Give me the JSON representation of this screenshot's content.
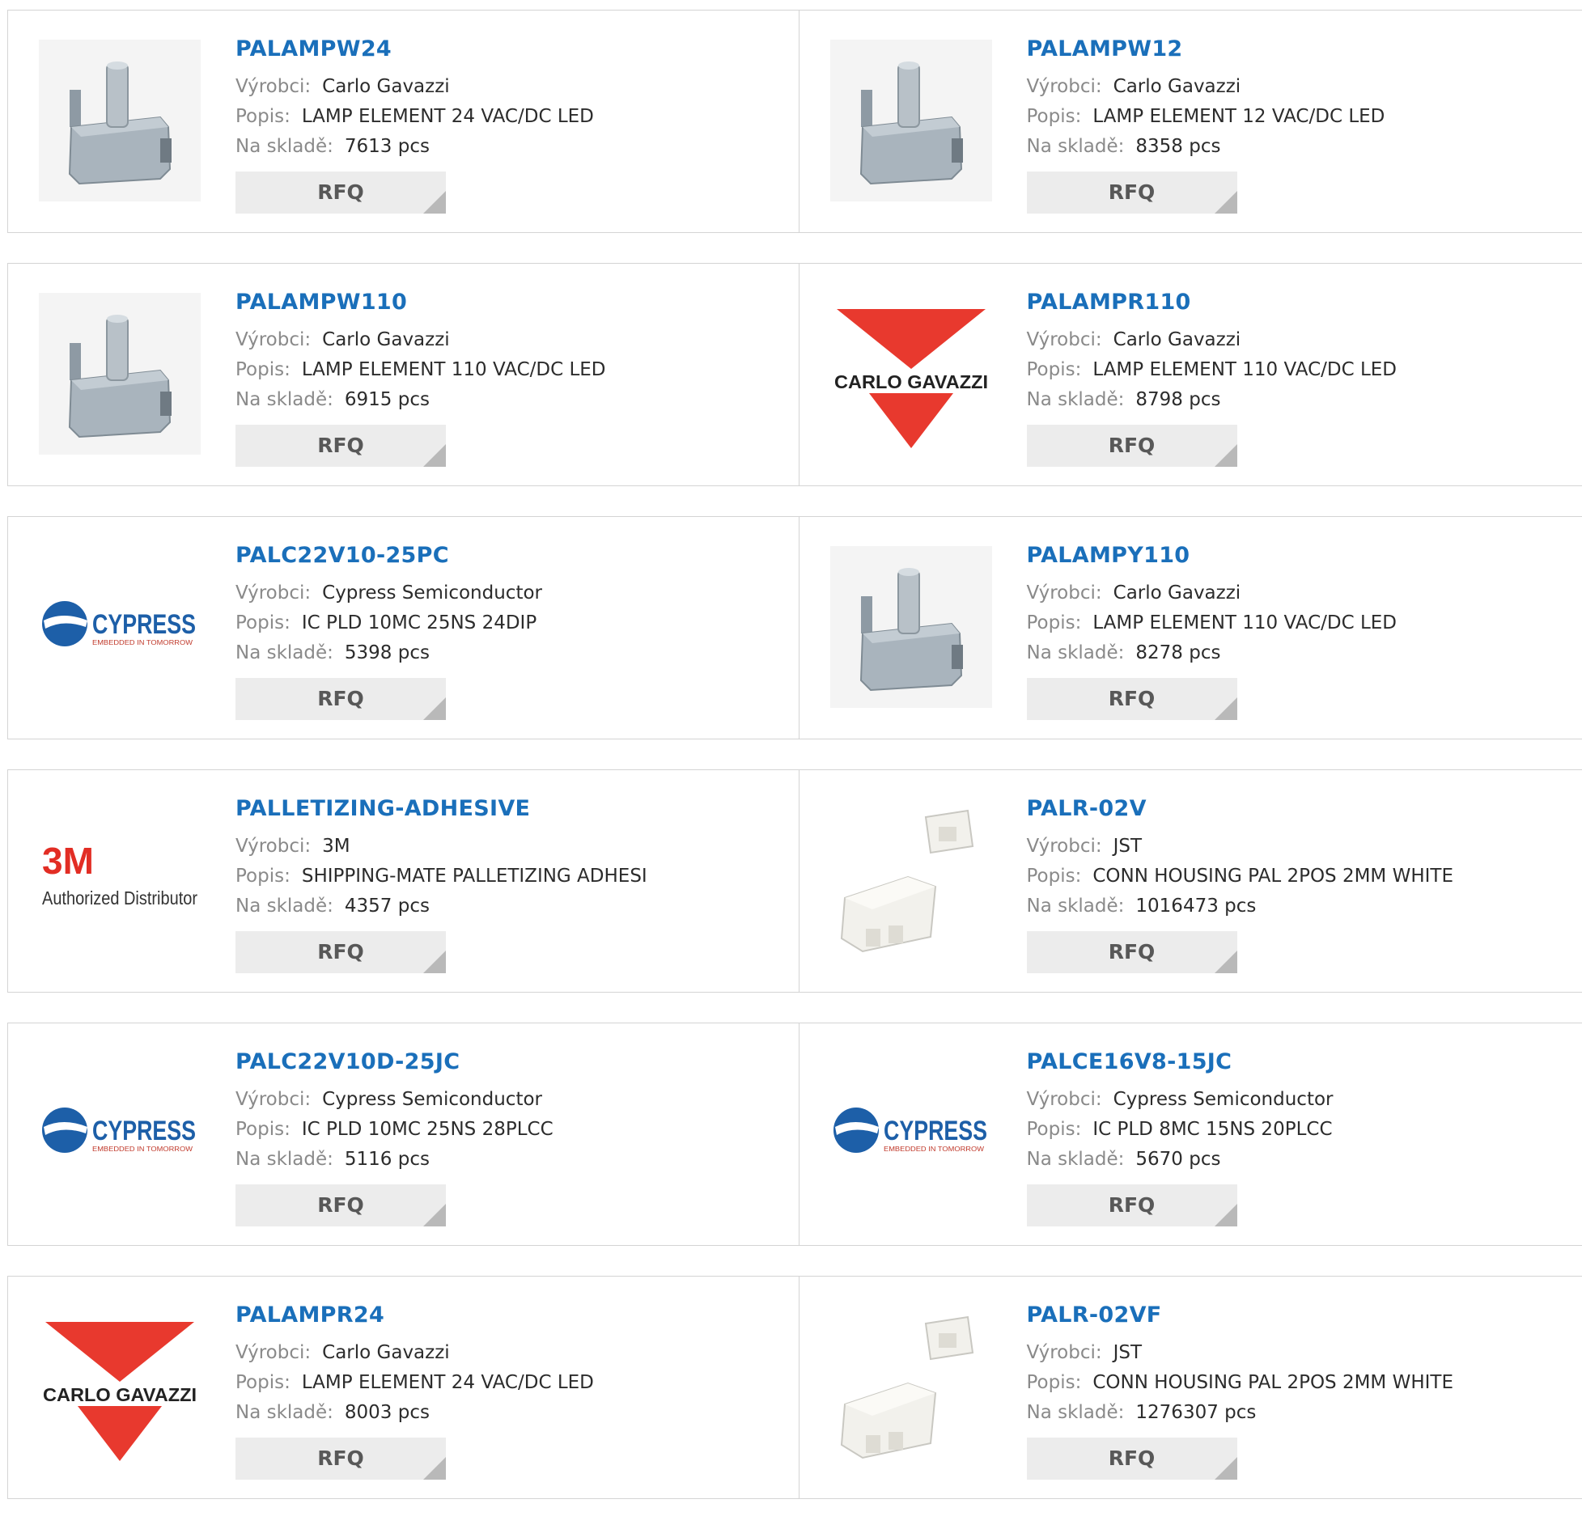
{
  "labels": {
    "manufacturer": "Výrobci:",
    "description": "Popis:",
    "stock": "Na skladě:",
    "rfq": "RFQ"
  },
  "colors": {
    "part_link": "#1a6fba",
    "cg_red": "#e8392e",
    "cypress_blue": "#1d5fa8",
    "m3_red": "#e22d24"
  },
  "products": [
    {
      "part": "PALAMPW24",
      "manufacturer": "Carlo Gavazzi",
      "description": "LAMP ELEMENT 24 VAC/DC LED",
      "stock": "7613 pcs",
      "image": "lamp-element-photo"
    },
    {
      "part": "PALAMPW12",
      "manufacturer": "Carlo Gavazzi",
      "description": "LAMP ELEMENT 12 VAC/DC LED",
      "stock": "8358 pcs",
      "image": "lamp-element-photo"
    },
    {
      "part": "PALAMPW110",
      "manufacturer": "Carlo Gavazzi",
      "description": "LAMP ELEMENT 110 VAC/DC LED",
      "stock": "6915 pcs",
      "image": "lamp-element-photo"
    },
    {
      "part": "PALAMPR110",
      "manufacturer": "Carlo Gavazzi",
      "description": "LAMP ELEMENT 110 VAC/DC LED",
      "stock": "8798 pcs",
      "image": "carlo-gavazzi-logo",
      "logo_text": "CARLO GAVAZZI"
    },
    {
      "part": "PALC22V10-25PC",
      "manufacturer": "Cypress Semiconductor",
      "description": "IC PLD 10MC 25NS 24DIP",
      "stock": "5398 pcs",
      "image": "cypress-logo",
      "logo_text": "CYPRESS",
      "logo_sub": "EMBEDDED IN TOMORROW"
    },
    {
      "part": "PALAMPY110",
      "manufacturer": "Carlo Gavazzi",
      "description": "LAMP ELEMENT 110 VAC/DC LED",
      "stock": "8278 pcs",
      "image": "lamp-element-photo"
    },
    {
      "part": "PALLETIZING-ADHESIVE",
      "manufacturer": "3M",
      "description": "SHIPPING-MATE PALLETIZING ADHESI",
      "stock": "4357 pcs",
      "image": "3m-logo",
      "logo_text": "3M",
      "logo_sub": "Authorized Distributor"
    },
    {
      "part": "PALR-02V",
      "manufacturer": "JST",
      "description": "CONN HOUSING PAL 2POS 2MM WHITE",
      "stock": "1016473 pcs",
      "image": "connector-housing-photo"
    },
    {
      "part": "PALC22V10D-25JC",
      "manufacturer": "Cypress Semiconductor",
      "description": "IC PLD 10MC 25NS 28PLCC",
      "stock": "5116 pcs",
      "image": "cypress-logo",
      "logo_text": "CYPRESS",
      "logo_sub": "EMBEDDED IN TOMORROW"
    },
    {
      "part": "PALCE16V8-15JC",
      "manufacturer": "Cypress Semiconductor",
      "description": "IC PLD 8MC 15NS 20PLCC",
      "stock": "5670 pcs",
      "image": "cypress-logo",
      "logo_text": "CYPRESS",
      "logo_sub": "EMBEDDED IN TOMORROW"
    },
    {
      "part": "PALAMPR24",
      "manufacturer": "Carlo Gavazzi",
      "description": "LAMP ELEMENT 24 VAC/DC LED",
      "stock": "8003 pcs",
      "image": "carlo-gavazzi-logo",
      "logo_text": "CARLO GAVAZZI"
    },
    {
      "part": "PALR-02VF",
      "manufacturer": "JST",
      "description": "CONN HOUSING PAL 2POS 2MM WHITE",
      "stock": "1276307 pcs",
      "image": "connector-housing-photo"
    }
  ]
}
